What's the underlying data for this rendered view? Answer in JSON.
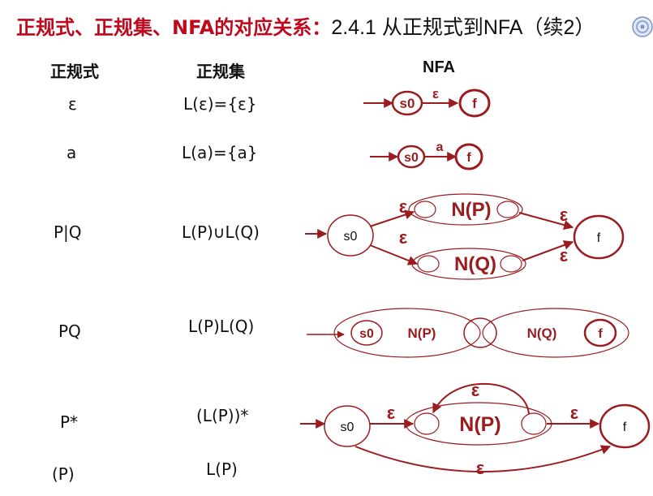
{
  "title": {
    "part1": "正规式、正规集、NFA的对应关系：",
    "part2": "2.4.1 从正规式到NFA（续2）"
  },
  "columns": {
    "regex": "正规式",
    "regset": "正规集",
    "nfa": "NFA"
  },
  "rows": [
    {
      "regex": "ε",
      "regset": "L(ε)={ε}"
    },
    {
      "regex": "a",
      "regset": "L(a)={a}"
    },
    {
      "regex": "P|Q",
      "regset": "L(P)∪L(Q)"
    },
    {
      "regex": "PQ",
      "regset": "L(P)L(Q)"
    },
    {
      "regex": "P*",
      "regset": "(L(P))*"
    },
    {
      "regex": "(P)",
      "regset": "L(P)"
    }
  ],
  "nfa": {
    "eps": {
      "start": "s0",
      "edge": "ε",
      "final": "f"
    },
    "sym": {
      "start": "s0",
      "edge": "a",
      "final": "f"
    },
    "union": {
      "start": "s0",
      "final": "f",
      "p": "N(P)",
      "q": "N(Q)",
      "eps": "ε"
    },
    "concat": {
      "start": "s0",
      "p": "N(P)",
      "q": "N(Q)",
      "final": "f"
    },
    "star": {
      "start": "s0",
      "final": "f",
      "p": "N(P)",
      "eps": "ε"
    }
  },
  "colors": {
    "accent": "#9b1b1e",
    "title_red": "#c0081c",
    "text": "#111111"
  }
}
